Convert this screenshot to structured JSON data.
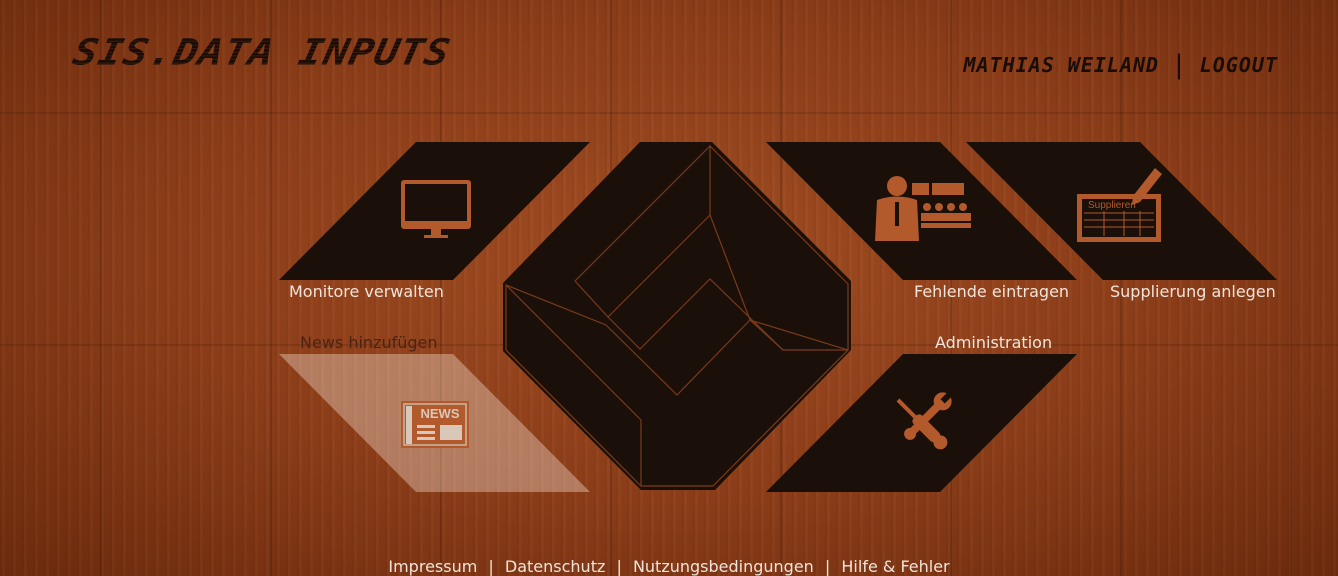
{
  "header": {
    "logo": "SIS.DATA INPUTS",
    "user_name": "MATHIAS WEILAND",
    "separator": "|",
    "logout_label": "LOGOUT"
  },
  "tiles": {
    "monitors": {
      "label": "Monitore verwalten",
      "icon": "monitor-icon"
    },
    "news": {
      "label": "News hinzufügen",
      "icon": "newspaper-icon",
      "badge": "NEWS"
    },
    "absent": {
      "label": "Fehlende eintragen",
      "icon": "teacher-class-icon"
    },
    "substitution": {
      "label": "Supplierung anlegen",
      "icon": "substitution-sheet-icon",
      "sheet_text": "Supplieren"
    },
    "admin": {
      "label": "Administration",
      "icon": "wrench-screwdriver-icon"
    }
  },
  "footer": {
    "links": [
      "Impressum",
      "Datenschutz",
      "Nutzungsbedingungen",
      "Hilfe & Fehler"
    ],
    "separator": "|"
  },
  "colors": {
    "tile": "#1b0f09",
    "icon": "#b25a2c",
    "label": "#f1e4da",
    "news_tile": "rgba(255,240,230,0.35)"
  }
}
